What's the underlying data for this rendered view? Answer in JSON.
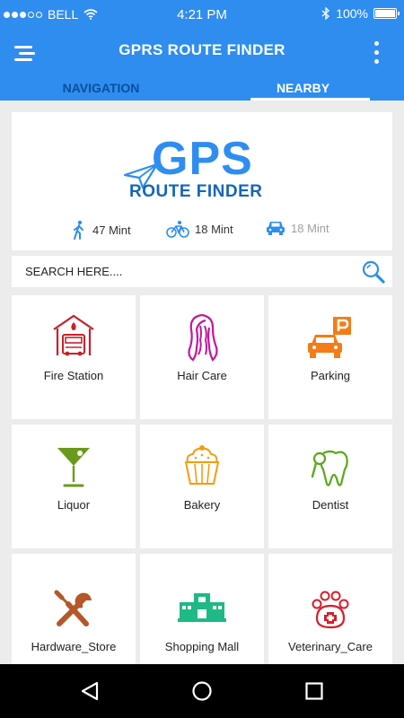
{
  "status_bar": {
    "carrier": "BELL",
    "time": "4:21 PM",
    "battery": "100%",
    "signal_bars_filled": 3,
    "signal_bars_total": 5
  },
  "app_bar": {
    "title": "GPRS ROUTE FINDER",
    "tabs": [
      {
        "label": "NAVIGATION",
        "active": false
      },
      {
        "label": "NEARBY",
        "active": true
      }
    ]
  },
  "header_card": {
    "logo_line1": "GPS",
    "logo_line2": "ROUTE FINDER",
    "modes": [
      {
        "icon": "walk-icon",
        "label": "47 Mint",
        "dim": false
      },
      {
        "icon": "bicycle-icon",
        "label": "18 Mint",
        "dim": false
      },
      {
        "icon": "car-icon",
        "label": "18 Mint",
        "dim": true
      }
    ]
  },
  "search": {
    "placeholder": "SEARCH HERE....",
    "value": ""
  },
  "categories": [
    {
      "label": "Fire Station",
      "icon": "fire-station-icon"
    },
    {
      "label": "Hair Care",
      "icon": "hair-care-icon"
    },
    {
      "label": "Parking",
      "icon": "parking-icon"
    },
    {
      "label": "Liquor",
      "icon": "liquor-icon"
    },
    {
      "label": "Bakery",
      "icon": "bakery-icon"
    },
    {
      "label": "Dentist",
      "icon": "dentist-icon"
    },
    {
      "label": "Hardware_Store",
      "icon": "hardware-store-icon"
    },
    {
      "label": "Shopping Mall",
      "icon": "shopping-mall-icon"
    },
    {
      "label": "Veterinary_Care",
      "icon": "veterinary-care-icon"
    }
  ],
  "colors": {
    "primary": "#2f8df0",
    "tab_inactive": "#0a4f9a",
    "fire": "#c8202a",
    "hair": "#c2189b",
    "parking": "#f47c16",
    "liquor": "#6a9a1c",
    "bakery": "#f39c12",
    "dentist": "#58a81a",
    "hardware": "#b4582a",
    "mall": "#1fb985",
    "vet": "#d81e2a"
  }
}
